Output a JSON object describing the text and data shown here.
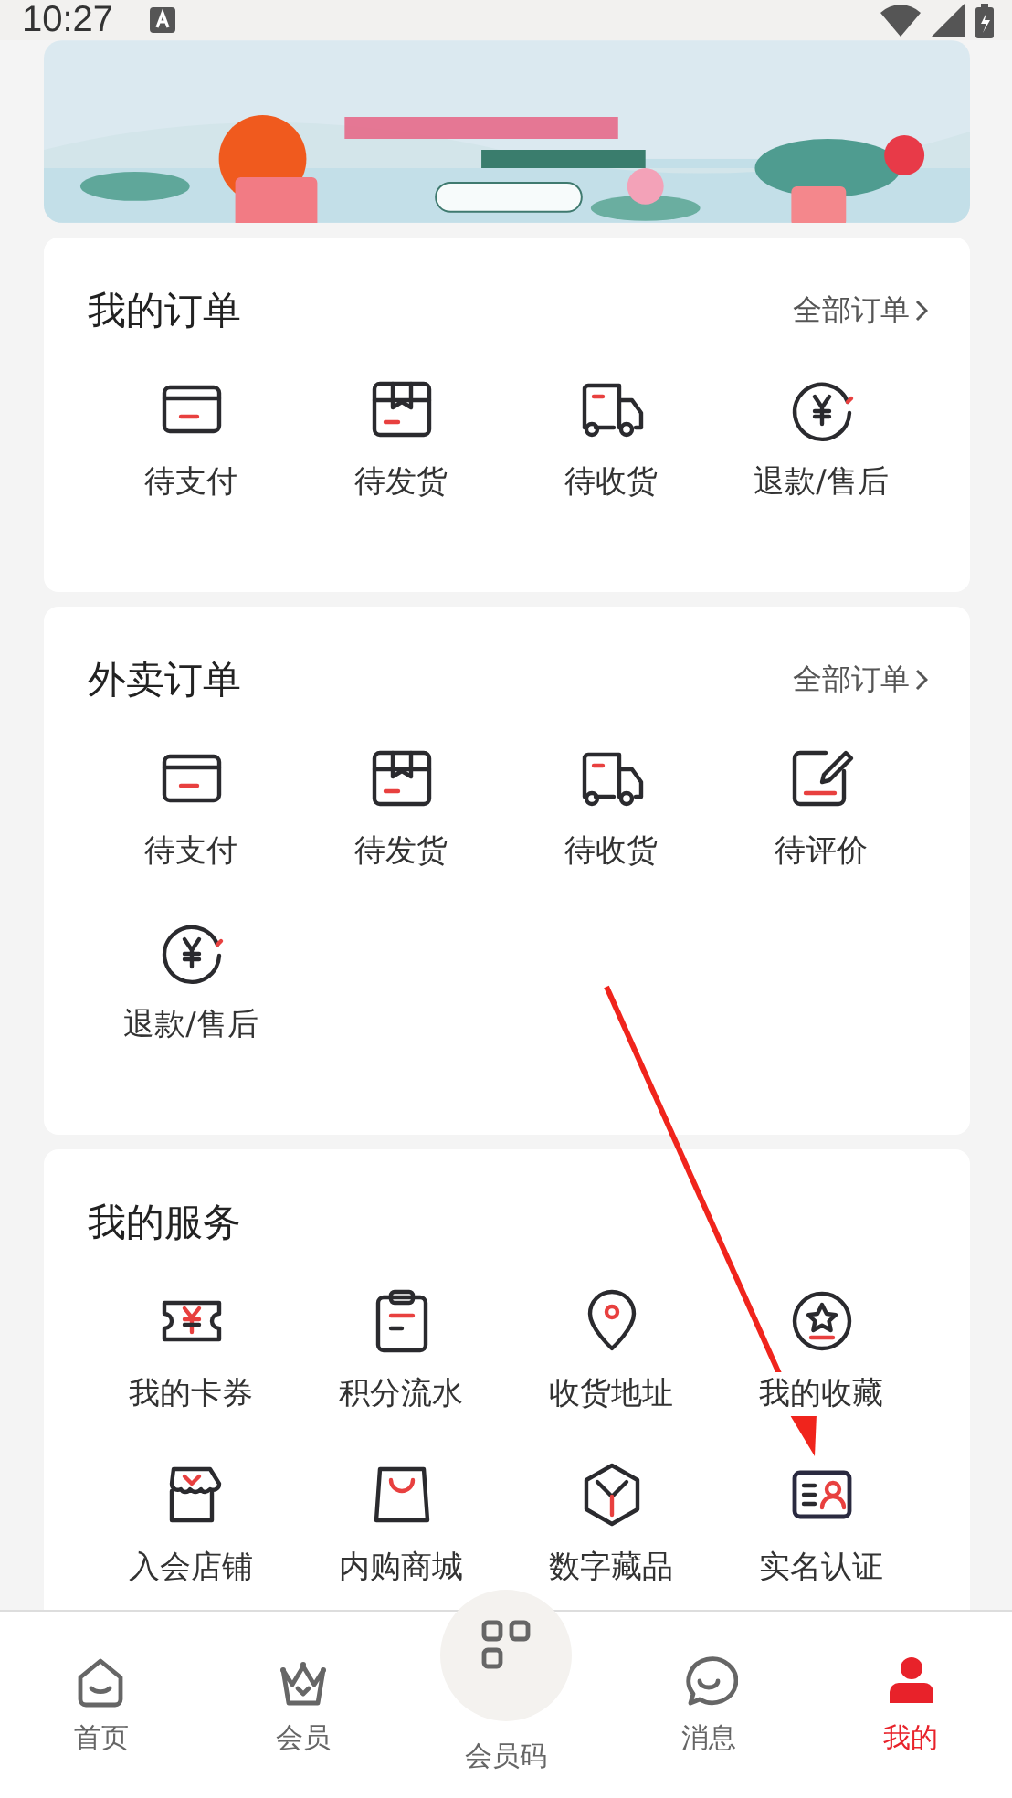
{
  "status_bar": {
    "time": "10:27"
  },
  "sections": [
    {
      "title": "我的订单",
      "link": "全部订单",
      "items": [
        {
          "label": "待支付"
        },
        {
          "label": "待发货"
        },
        {
          "label": "待收货"
        },
        {
          "label": "退款/售后"
        }
      ]
    },
    {
      "title": "外卖订单",
      "link": "全部订单",
      "items": [
        {
          "label": "待支付"
        },
        {
          "label": "待发货"
        },
        {
          "label": "待收货"
        },
        {
          "label": "待评价"
        },
        {
          "label": "退款/售后"
        }
      ]
    },
    {
      "title": "我的服务",
      "items": [
        {
          "label": "我的卡券"
        },
        {
          "label": "积分流水"
        },
        {
          "label": "收货地址"
        },
        {
          "label": "我的收藏"
        },
        {
          "label": "入会店铺"
        },
        {
          "label": "内购商城"
        },
        {
          "label": "数字藏品"
        },
        {
          "label": "实名认证"
        }
      ]
    }
  ],
  "tab_bar": [
    {
      "label": "首页",
      "selected": false
    },
    {
      "label": "会员",
      "selected": false
    },
    {
      "label": "会员码",
      "selected": false
    },
    {
      "label": "消息",
      "selected": false
    },
    {
      "label": "我的",
      "selected": true
    }
  ]
}
